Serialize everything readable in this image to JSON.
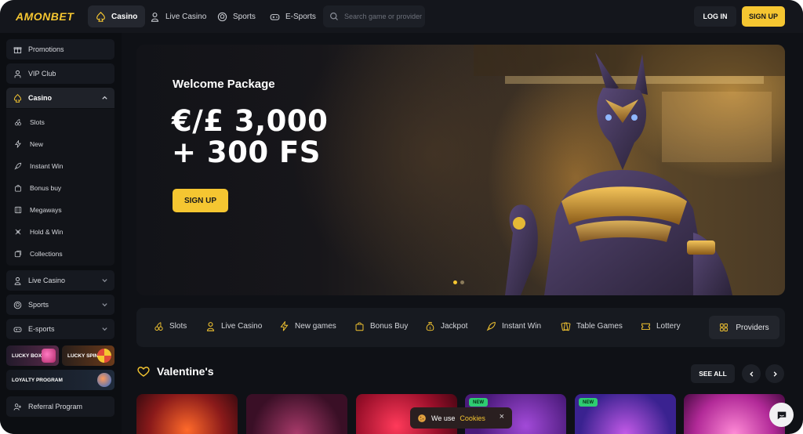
{
  "brand": {
    "logo": "AMONBET"
  },
  "nav": {
    "tabs": [
      {
        "label": "Casino",
        "icon": "spade-icon"
      },
      {
        "label": "Live Casino",
        "icon": "dealer-icon"
      },
      {
        "label": "Sports",
        "icon": "ball-icon"
      },
      {
        "label": "E-Sports",
        "icon": "gamepad-icon"
      }
    ],
    "search_placeholder": "Search game or provider",
    "login_label": "LOG IN",
    "signup_label": "SIGN UP"
  },
  "sidebar": {
    "top_items": [
      {
        "label": "Promotions",
        "icon": "gift-icon"
      },
      {
        "label": "VIP Club",
        "icon": "person-icon"
      }
    ],
    "casino": {
      "label": "Casino",
      "sub_items": [
        {
          "label": "Slots",
          "icon": "cherry-icon"
        },
        {
          "label": "New",
          "icon": "bolt-icon"
        },
        {
          "label": "Instant Win",
          "icon": "rocket-icon"
        },
        {
          "label": "Bonus buy",
          "icon": "bag-icon"
        },
        {
          "label": "Megaways",
          "icon": "grid-icon"
        },
        {
          "label": "Hold & Win",
          "icon": "cross-icon"
        },
        {
          "label": "Collections",
          "icon": "collections-icon"
        }
      ]
    },
    "bottom_items": [
      {
        "label": "Live Casino",
        "icon": "dealer-icon"
      },
      {
        "label": "Sports",
        "icon": "ball-icon"
      },
      {
        "label": "E-sports",
        "icon": "gamepad-icon"
      }
    ],
    "promo_cards": [
      {
        "label": "LUCKY BOX"
      },
      {
        "label": "LUCKY SPIN"
      },
      {
        "label": "LOYALTY PROGRAM"
      }
    ],
    "referral": {
      "label": "Referral Program",
      "icon": "referral-icon"
    }
  },
  "hero": {
    "title": "Welcome Package",
    "amount_line1": "€/£ 3,000",
    "amount_line2": "+ 300 FS",
    "cta_label": "SIGN UP",
    "slide_count": 2,
    "active_slide": 1
  },
  "categories": [
    {
      "label": "Slots",
      "icon": "cherry-icon"
    },
    {
      "label": "Live Casino",
      "icon": "dealer-icon"
    },
    {
      "label": "New games",
      "icon": "bolt-icon"
    },
    {
      "label": "Bonus Buy",
      "icon": "bag-icon"
    },
    {
      "label": "Jackpot",
      "icon": "moneybag-icon"
    },
    {
      "label": "Instant Win",
      "icon": "rocket-icon"
    },
    {
      "label": "Table Games",
      "icon": "cards-icon"
    },
    {
      "label": "Lottery",
      "icon": "ticket-icon"
    }
  ],
  "providers_label": "Providers",
  "section": {
    "title": "Valentine's",
    "see_all_label": "SEE ALL",
    "badge_label": "NEW"
  },
  "cookie": {
    "text": "We use",
    "link": "Cookies",
    "close": "×"
  },
  "colors": {
    "accent": "#f5c631",
    "background": "#0f1116",
    "badge_new": "#2ecc71"
  }
}
